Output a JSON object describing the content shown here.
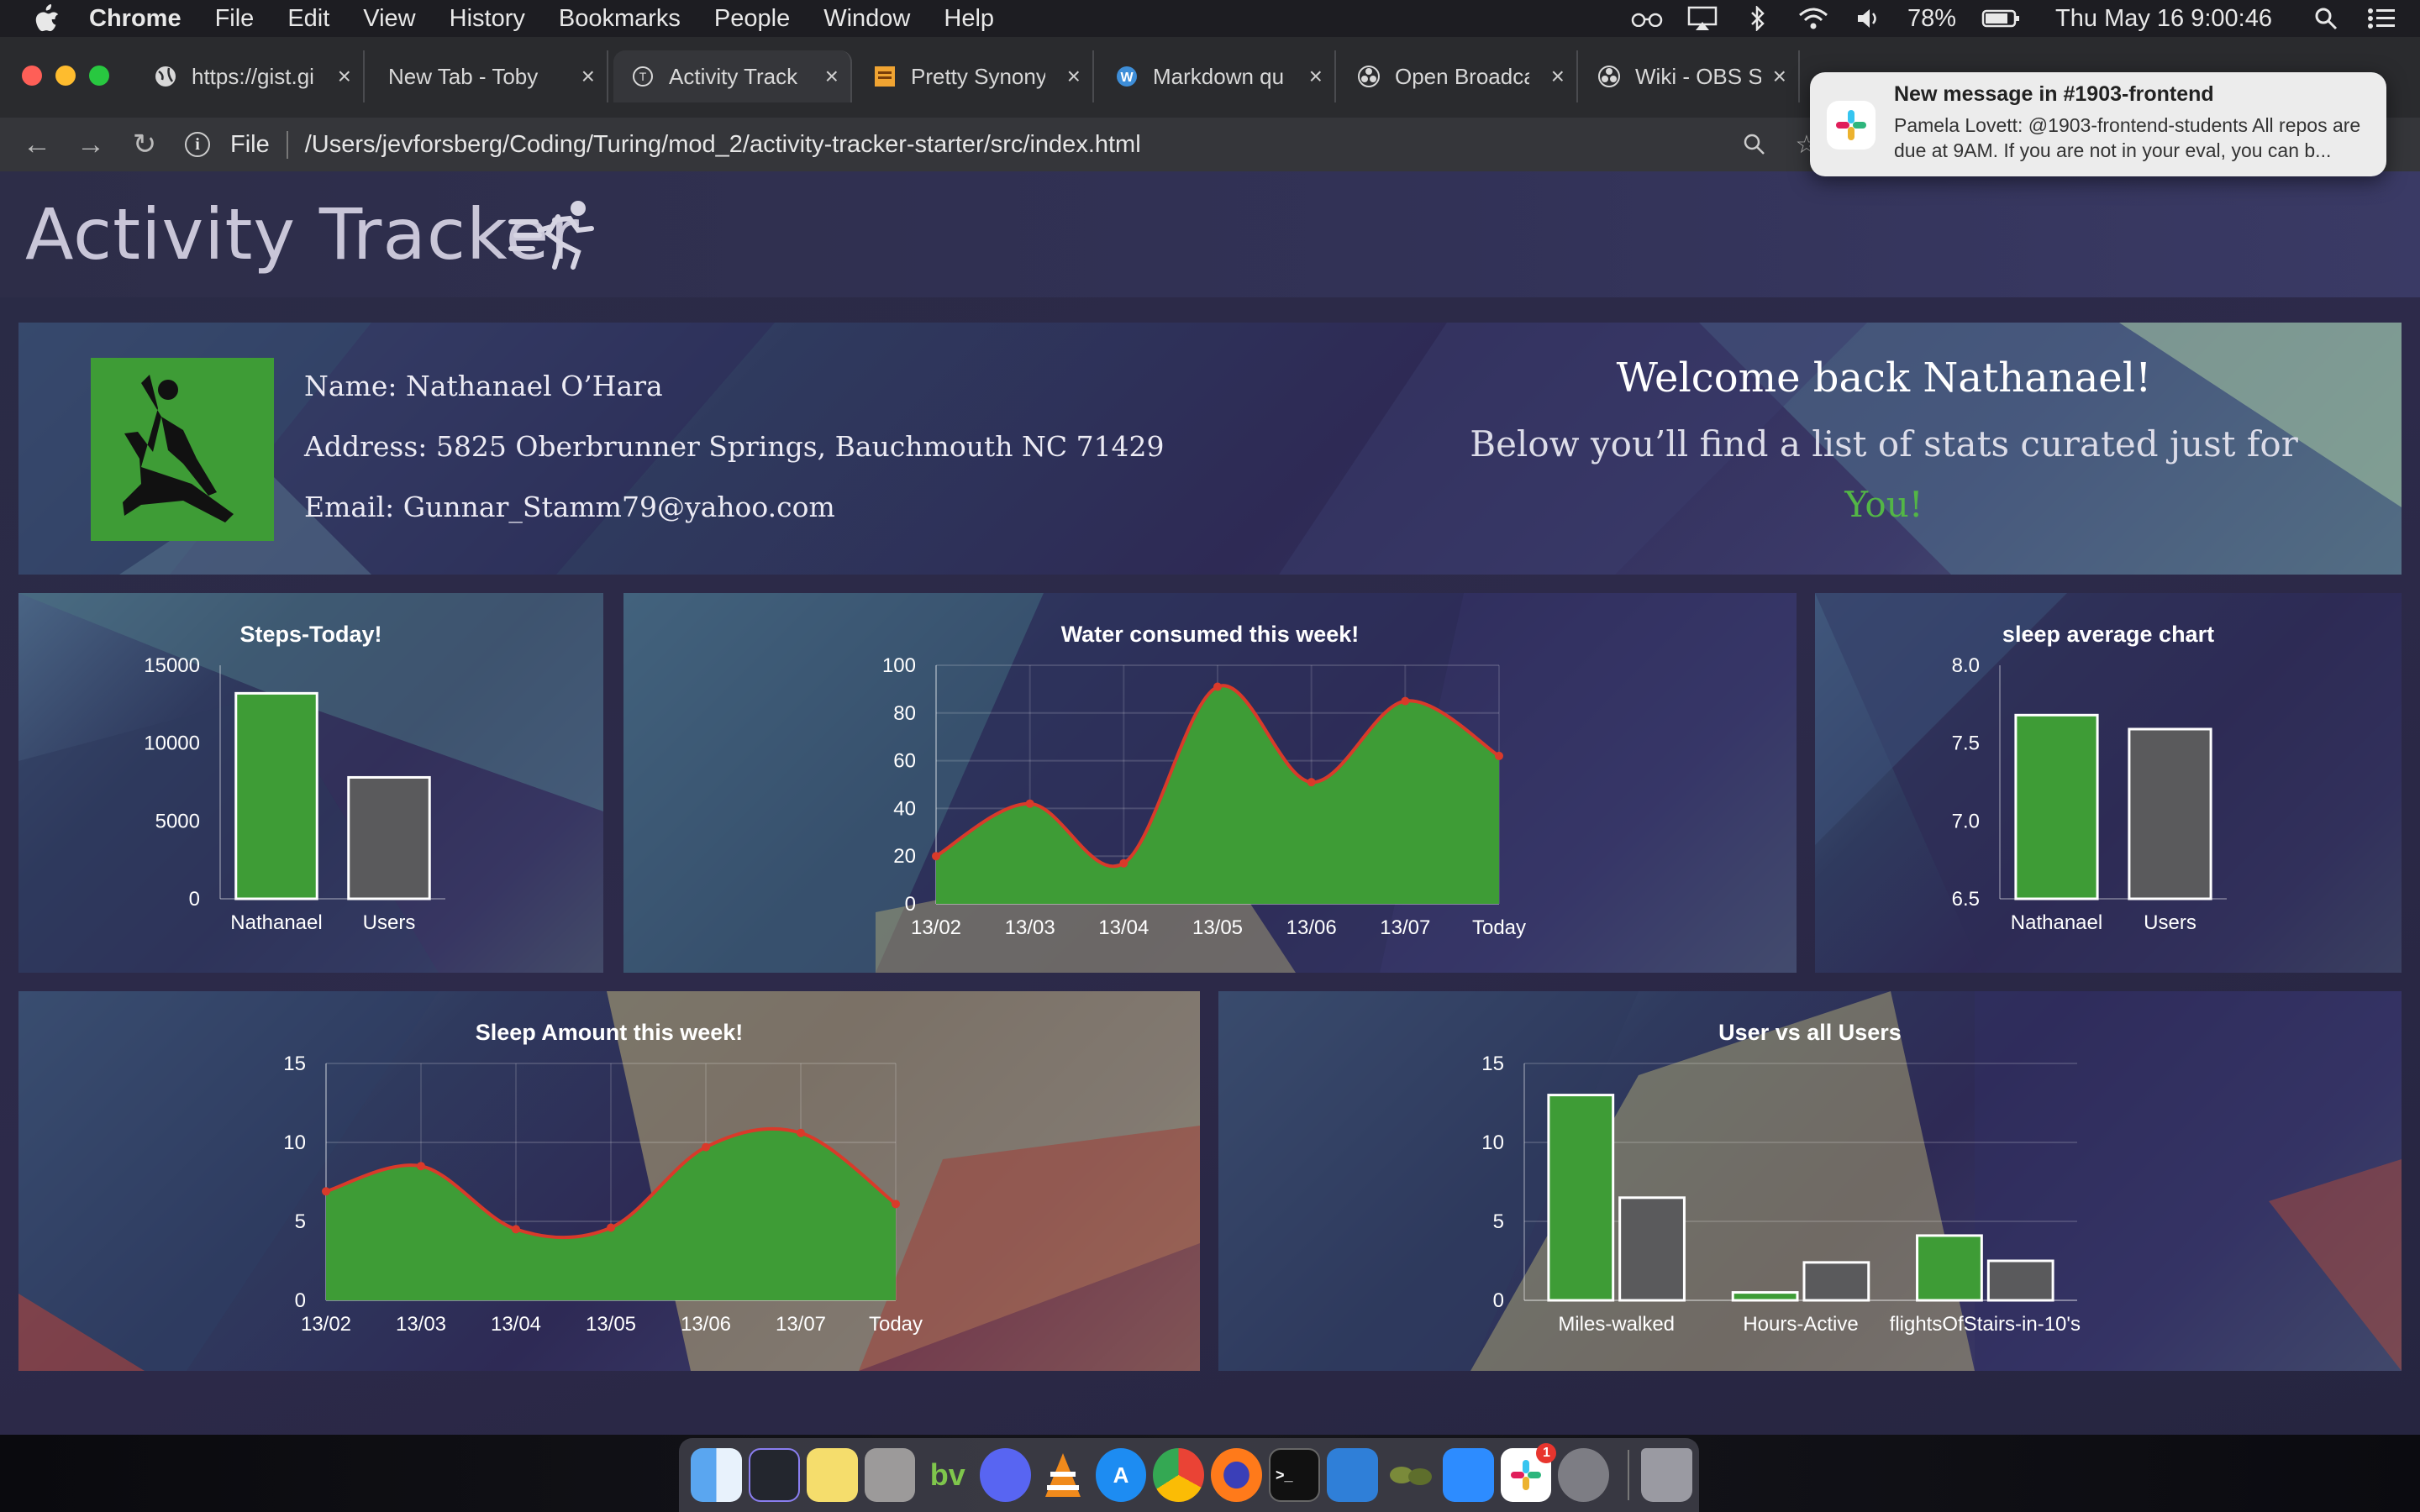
{
  "menubar": {
    "app_name": "Chrome",
    "items": [
      "File",
      "Edit",
      "View",
      "History",
      "Bookmarks",
      "People",
      "Window",
      "Help"
    ],
    "battery": "78%",
    "datetime": "Thu May 16  9:00:46"
  },
  "tabs": [
    {
      "title": "https://gist.gi",
      "icon": "globe-icon"
    },
    {
      "title": "New Tab - Toby",
      "icon": "none"
    },
    {
      "title": "Activity Track",
      "icon": "turing-icon"
    },
    {
      "title": "Pretty Synony",
      "icon": "bookmark-icon"
    },
    {
      "title": "Markdown qu",
      "icon": "wordpress-icon"
    },
    {
      "title": "Open Broadca",
      "icon": "obs-icon"
    },
    {
      "title": "Wiki - OBS St",
      "icon": "obs-icon"
    }
  ],
  "address": {
    "scheme_label": "File",
    "url": "/Users/jevforsberg/Coding/Turing/mod_2/activity-tracker-starter/src/index.html"
  },
  "notification": {
    "title": "New message in #1903-frontend",
    "body": "Pamela Lovett: @1903-frontend-students All repos are due at 9AM. If you are not in your eval, you can b..."
  },
  "page": {
    "title": "Activity Tracker"
  },
  "profile": {
    "name": "Name: Nathanael O’Hara",
    "address": "Address: 5825 Oberbrunner Springs, Bauchmouth NC 71429",
    "email": "Email: Gunnar_Stamm79@yahoo.com",
    "welcome": "Welcome back Nathanael!",
    "subtitle": "Below you’ll find a list of stats curated just for",
    "highlight": "You!"
  },
  "colors": {
    "user_bar": "#3e9c36",
    "all_users_bar": "#5a5a5c",
    "line": "#d93a2a"
  },
  "chart_data": [
    {
      "id": "steps",
      "type": "bar",
      "title": "Steps-Today!",
      "categories": [
        "Nathanael",
        "Users"
      ],
      "values": [
        13200,
        7800
      ],
      "ylim": [
        0,
        15000
      ],
      "yticks": [
        "0",
        "5000",
        "10000",
        "15000"
      ],
      "grid": false
    },
    {
      "id": "water",
      "type": "area",
      "title": "Water consumed this week!",
      "categories": [
        "13/02",
        "13/03",
        "13/04",
        "13/05",
        "13/06",
        "13/07",
        "Today"
      ],
      "values": [
        20,
        42,
        17,
        91,
        51,
        85,
        62
      ],
      "ylim": [
        0,
        100
      ],
      "yticks": [
        "0",
        "20",
        "40",
        "60",
        "80",
        "100"
      ],
      "grid": true
    },
    {
      "id": "sleep_avg",
      "type": "bar",
      "title": "sleep average chart",
      "categories": [
        "Nathanael",
        "Users"
      ],
      "values": [
        7.68,
        7.59
      ],
      "ylim": [
        6.5,
        8.0
      ],
      "yticks": [
        "6.5",
        "7.0",
        "7.5",
        "8.0"
      ],
      "grid": false
    },
    {
      "id": "sleep_week",
      "type": "area",
      "title": "Sleep Amount this week!",
      "categories": [
        "13/02",
        "13/03",
        "13/04",
        "13/05",
        "13/06",
        "13/07",
        "Today"
      ],
      "values": [
        6.9,
        8.5,
        4.5,
        4.6,
        9.7,
        10.6,
        6.1
      ],
      "ylim": [
        0,
        15
      ],
      "yticks": [
        "0",
        "5",
        "10",
        "15"
      ],
      "grid": true
    },
    {
      "id": "compare",
      "type": "bar",
      "title": "User vs all Users",
      "categories": [
        "Miles-walked",
        "Hours-Active",
        "flightsOfStairs-in-10's"
      ],
      "series": [
        {
          "values": [
            13,
            0.5,
            4.1
          ]
        },
        {
          "values": [
            6.5,
            2.4,
            2.5
          ]
        }
      ],
      "ylim": [
        0,
        15
      ],
      "yticks": [
        "0",
        "5",
        "10",
        "15"
      ],
      "grid": true
    }
  ],
  "dock": {
    "items": [
      "finder",
      "screenshot",
      "stickies",
      "script-editor",
      "bv",
      "discord",
      "vlc",
      "app-store",
      "chrome",
      "firefox",
      "terminal",
      "vscode",
      "frogs",
      "zoom",
      "slack",
      "system-preferences",
      "trash"
    ],
    "slack_badge": "1"
  }
}
